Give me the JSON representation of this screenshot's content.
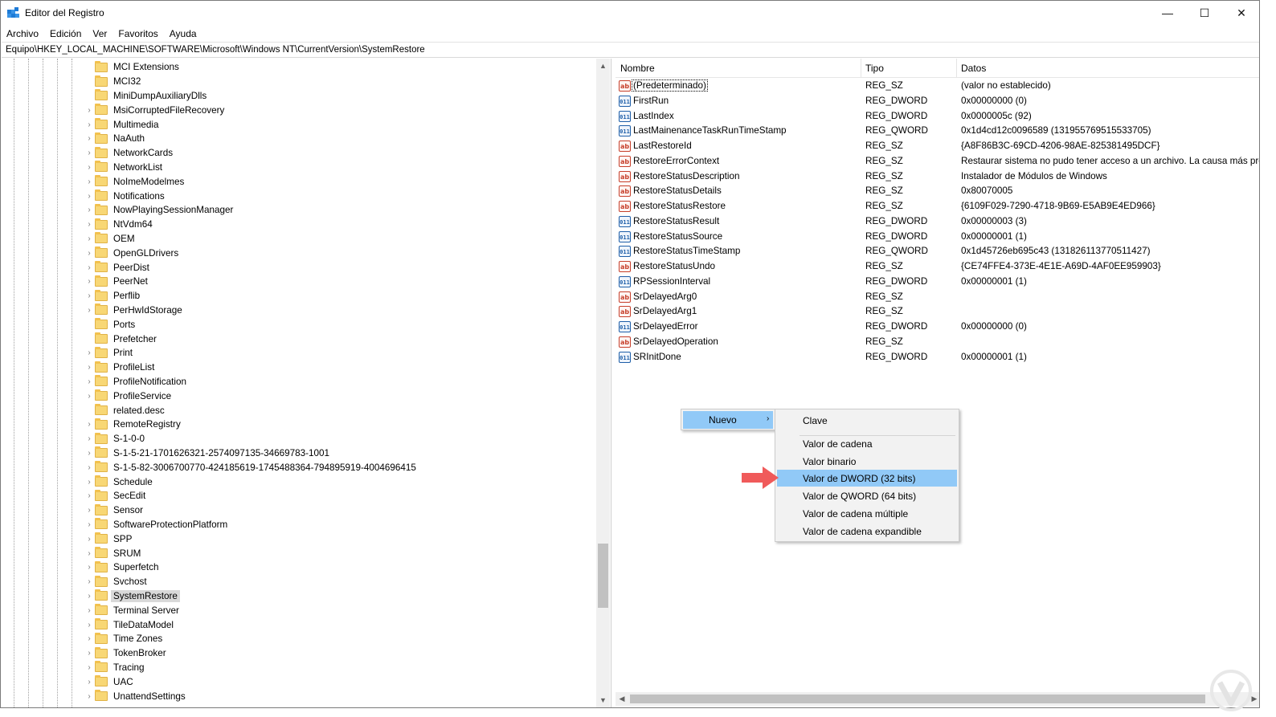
{
  "window": {
    "title": "Editor del Registro",
    "minimize": "—",
    "maximize": "☐",
    "close": "✕"
  },
  "menu": [
    "Archivo",
    "Edición",
    "Ver",
    "Favoritos",
    "Ayuda"
  ],
  "address": "Equipo\\HKEY_LOCAL_MACHINE\\SOFTWARE\\Microsoft\\Windows NT\\CurrentVersion\\SystemRestore",
  "tree": {
    "items": [
      {
        "label": "MCI Extensions",
        "expandable": false
      },
      {
        "label": "MCI32",
        "expandable": false
      },
      {
        "label": "MiniDumpAuxiliaryDlls",
        "expandable": false
      },
      {
        "label": "MsiCorruptedFileRecovery",
        "expandable": true
      },
      {
        "label": "Multimedia",
        "expandable": true
      },
      {
        "label": "NaAuth",
        "expandable": true
      },
      {
        "label": "NetworkCards",
        "expandable": true
      },
      {
        "label": "NetworkList",
        "expandable": true
      },
      {
        "label": "NoImeModelmes",
        "expandable": true
      },
      {
        "label": "Notifications",
        "expandable": true
      },
      {
        "label": "NowPlayingSessionManager",
        "expandable": true
      },
      {
        "label": "NtVdm64",
        "expandable": true
      },
      {
        "label": "OEM",
        "expandable": true
      },
      {
        "label": "OpenGLDrivers",
        "expandable": true
      },
      {
        "label": "PeerDist",
        "expandable": true
      },
      {
        "label": "PeerNet",
        "expandable": true
      },
      {
        "label": "Perflib",
        "expandable": true
      },
      {
        "label": "PerHwIdStorage",
        "expandable": true
      },
      {
        "label": "Ports",
        "expandable": false
      },
      {
        "label": "Prefetcher",
        "expandable": false
      },
      {
        "label": "Print",
        "expandable": true
      },
      {
        "label": "ProfileList",
        "expandable": true
      },
      {
        "label": "ProfileNotification",
        "expandable": true
      },
      {
        "label": "ProfileService",
        "expandable": true
      },
      {
        "label": "related.desc",
        "expandable": false
      },
      {
        "label": "RemoteRegistry",
        "expandable": true
      },
      {
        "label": "S-1-0-0",
        "expandable": true
      },
      {
        "label": "S-1-5-21-1701626321-2574097135-34669783-1001",
        "expandable": true
      },
      {
        "label": "S-1-5-82-3006700770-424185619-1745488364-794895919-4004696415",
        "expandable": true
      },
      {
        "label": "Schedule",
        "expandable": true
      },
      {
        "label": "SecEdit",
        "expandable": true
      },
      {
        "label": "Sensor",
        "expandable": true
      },
      {
        "label": "SoftwareProtectionPlatform",
        "expandable": true
      },
      {
        "label": "SPP",
        "expandable": true
      },
      {
        "label": "SRUM",
        "expandable": true
      },
      {
        "label": "Superfetch",
        "expandable": true
      },
      {
        "label": "Svchost",
        "expandable": true
      },
      {
        "label": "SystemRestore",
        "expandable": true,
        "selected": true
      },
      {
        "label": "Terminal Server",
        "expandable": true
      },
      {
        "label": "TileDataModel",
        "expandable": true
      },
      {
        "label": "Time Zones",
        "expandable": true
      },
      {
        "label": "TokenBroker",
        "expandable": true
      },
      {
        "label": "Tracing",
        "expandable": true
      },
      {
        "label": "UAC",
        "expandable": true
      },
      {
        "label": "UnattendSettings",
        "expandable": true
      }
    ]
  },
  "list": {
    "headers": {
      "name": "Nombre",
      "type": "Tipo",
      "data": "Datos"
    },
    "rows": [
      {
        "icon": "sz",
        "name": "(Predeterminado)",
        "type": "REG_SZ",
        "data": "(valor no establecido)"
      },
      {
        "icon": "dword",
        "name": "FirstRun",
        "type": "REG_DWORD",
        "data": "0x00000000 (0)"
      },
      {
        "icon": "dword",
        "name": "LastIndex",
        "type": "REG_DWORD",
        "data": "0x0000005c (92)"
      },
      {
        "icon": "dword",
        "name": "LastMainenanceTaskRunTimeStamp",
        "type": "REG_QWORD",
        "data": "0x1d4cd12c0096589 (131955769515533705)"
      },
      {
        "icon": "sz",
        "name": "LastRestoreId",
        "type": "REG_SZ",
        "data": "{A8F86B3C-69CD-4206-98AE-825381495DCF}"
      },
      {
        "icon": "sz",
        "name": "RestoreErrorContext",
        "type": "REG_SZ",
        "data": "Restaurar sistema no pudo tener acceso a un archivo. La causa más pro"
      },
      {
        "icon": "sz",
        "name": "RestoreStatusDescription",
        "type": "REG_SZ",
        "data": "Instalador de Módulos de Windows"
      },
      {
        "icon": "sz",
        "name": "RestoreStatusDetails",
        "type": "REG_SZ",
        "data": "0x80070005"
      },
      {
        "icon": "sz",
        "name": "RestoreStatusRestore",
        "type": "REG_SZ",
        "data": "{6109F029-7290-4718-9B69-E5AB9E4ED966}"
      },
      {
        "icon": "dword",
        "name": "RestoreStatusResult",
        "type": "REG_DWORD",
        "data": "0x00000003 (3)"
      },
      {
        "icon": "dword",
        "name": "RestoreStatusSource",
        "type": "REG_DWORD",
        "data": "0x00000001 (1)"
      },
      {
        "icon": "dword",
        "name": "RestoreStatusTimeStamp",
        "type": "REG_QWORD",
        "data": "0x1d45726eb695c43 (131826113770511427)"
      },
      {
        "icon": "sz",
        "name": "RestoreStatusUndo",
        "type": "REG_SZ",
        "data": "{CE74FFE4-373E-4E1E-A69D-4AF0EE959903}"
      },
      {
        "icon": "dword",
        "name": "RPSessionInterval",
        "type": "REG_DWORD",
        "data": "0x00000001 (1)"
      },
      {
        "icon": "sz",
        "name": "SrDelayedArg0",
        "type": "REG_SZ",
        "data": ""
      },
      {
        "icon": "sz",
        "name": "SrDelayedArg1",
        "type": "REG_SZ",
        "data": ""
      },
      {
        "icon": "dword",
        "name": "SrDelayedError",
        "type": "REG_DWORD",
        "data": "0x00000000 (0)"
      },
      {
        "icon": "sz",
        "name": "SrDelayedOperation",
        "type": "REG_SZ",
        "data": ""
      },
      {
        "icon": "dword",
        "name": "SRInitDone",
        "type": "REG_DWORD",
        "data": "0x00000001 (1)"
      }
    ]
  },
  "context_menu": {
    "parent": {
      "label": "Nuevo"
    },
    "submenu": [
      {
        "label": "Clave"
      },
      {
        "label": "Valor de cadena"
      },
      {
        "label": "Valor binario"
      },
      {
        "label": "Valor de DWORD (32 bits)",
        "highlighted": true
      },
      {
        "label": "Valor de QWORD (64 bits)"
      },
      {
        "label": "Valor de cadena múltiple"
      },
      {
        "label": "Valor de cadena expandible"
      }
    ]
  },
  "colors": {
    "menu_highlight": "#91c9f7",
    "arrow": "#f05a5a",
    "selection": "#d9d9d9"
  }
}
